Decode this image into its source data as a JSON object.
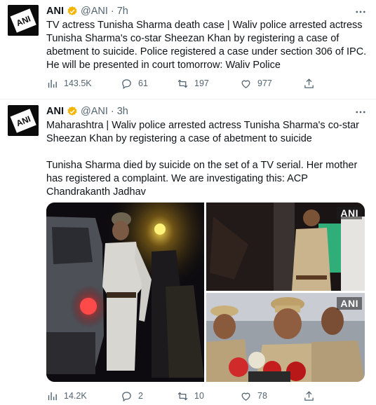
{
  "tweets": [
    {
      "author": {
        "name": "ANI",
        "handle": "@ANI",
        "time": "7h",
        "avatar_text": "ANI"
      },
      "text": "TV actress Tunisha Sharma death case | Waliv police arrested actress Tunisha Sharma's co-star Sheezan Khan by registering a case of abetment to suicide. Police registered a case under section 306 of IPC. He will be presented in court tomorrow: Waliv Police",
      "stats": {
        "views": "143.5K",
        "replies": "61",
        "retweets": "197",
        "likes": "977"
      }
    },
    {
      "author": {
        "name": "ANI",
        "handle": "@ANI",
        "time": "3h",
        "avatar_text": "ANI"
      },
      "paragraphs": [
        "Maharashtra | Waliv police arrested actress Tunisha Sharma's co-star Sheezan Khan by registering a case of abetment to suicide",
        "Tunisha Sharma died by suicide on the set of a TV serial. Her mother has registered a complaint. We are investigating this: ACP Chandrakanth Jadhav"
      ],
      "media": {
        "watermark_top_right": "ANI",
        "watermark_bottom_right": "ANI"
      },
      "stats": {
        "views": "14.2K",
        "replies": "2",
        "retweets": "10",
        "likes": "78"
      }
    }
  ],
  "separator": "·",
  "icons": {
    "verified": "verified-badge-icon",
    "more": "more-icon",
    "views": "views-icon",
    "reply": "reply-icon",
    "retweet": "retweet-icon",
    "like": "like-icon",
    "share": "share-icon"
  },
  "colors": {
    "verified": "#f4b400",
    "muted": "#536471",
    "text": "#0f1419"
  }
}
